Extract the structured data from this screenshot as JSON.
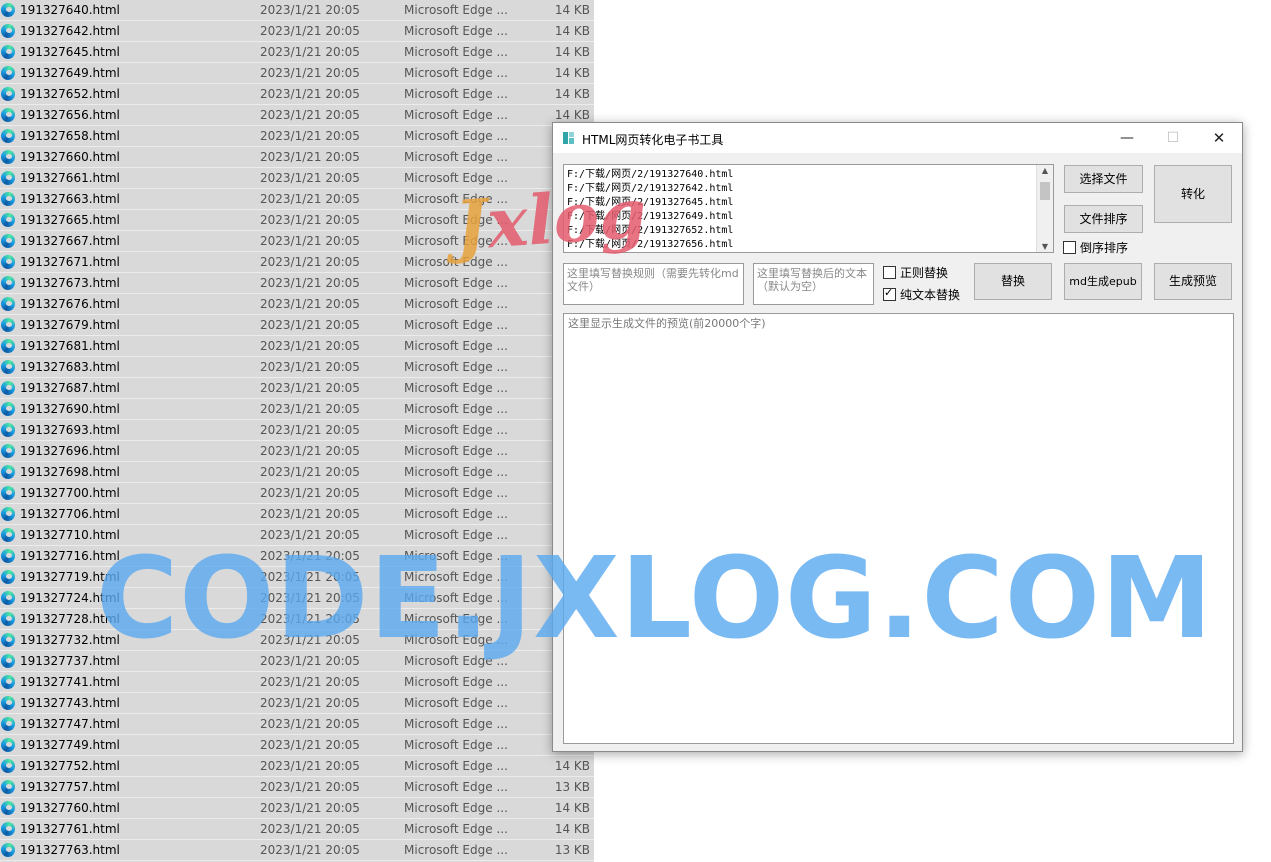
{
  "explorer": {
    "files": [
      {
        "name": "191327640.html",
        "date": "2023/1/21 20:05",
        "type": "Microsoft Edge ...",
        "size": "14 KB"
      },
      {
        "name": "191327642.html",
        "date": "2023/1/21 20:05",
        "type": "Microsoft Edge ...",
        "size": "14 KB"
      },
      {
        "name": "191327645.html",
        "date": "2023/1/21 20:05",
        "type": "Microsoft Edge ...",
        "size": "14 KB"
      },
      {
        "name": "191327649.html",
        "date": "2023/1/21 20:05",
        "type": "Microsoft Edge ...",
        "size": "14 KB"
      },
      {
        "name": "191327652.html",
        "date": "2023/1/21 20:05",
        "type": "Microsoft Edge ...",
        "size": "14 KB"
      },
      {
        "name": "191327656.html",
        "date": "2023/1/21 20:05",
        "type": "Microsoft Edge ...",
        "size": "14 KB"
      },
      {
        "name": "191327658.html",
        "date": "2023/1/21 20:05",
        "type": "Microsoft Edge ...",
        "size": ""
      },
      {
        "name": "191327660.html",
        "date": "2023/1/21 20:05",
        "type": "Microsoft Edge ...",
        "size": ""
      },
      {
        "name": "191327661.html",
        "date": "2023/1/21 20:05",
        "type": "Microsoft Edge ...",
        "size": ""
      },
      {
        "name": "191327663.html",
        "date": "2023/1/21 20:05",
        "type": "Microsoft Edge ...",
        "size": ""
      },
      {
        "name": "191327665.html",
        "date": "2023/1/21 20:05",
        "type": "Microsoft Edge ...",
        "size": ""
      },
      {
        "name": "191327667.html",
        "date": "2023/1/21 20:05",
        "type": "Microsoft Edge ...",
        "size": ""
      },
      {
        "name": "191327671.html",
        "date": "2023/1/21 20:05",
        "type": "Microsoft Edge ...",
        "size": ""
      },
      {
        "name": "191327673.html",
        "date": "2023/1/21 20:05",
        "type": "Microsoft Edge ...",
        "size": ""
      },
      {
        "name": "191327676.html",
        "date": "2023/1/21 20:05",
        "type": "Microsoft Edge ...",
        "size": ""
      },
      {
        "name": "191327679.html",
        "date": "2023/1/21 20:05",
        "type": "Microsoft Edge ...",
        "size": ""
      },
      {
        "name": "191327681.html",
        "date": "2023/1/21 20:05",
        "type": "Microsoft Edge ...",
        "size": ""
      },
      {
        "name": "191327683.html",
        "date": "2023/1/21 20:05",
        "type": "Microsoft Edge ...",
        "size": ""
      },
      {
        "name": "191327687.html",
        "date": "2023/1/21 20:05",
        "type": "Microsoft Edge ...",
        "size": ""
      },
      {
        "name": "191327690.html",
        "date": "2023/1/21 20:05",
        "type": "Microsoft Edge ...",
        "size": ""
      },
      {
        "name": "191327693.html",
        "date": "2023/1/21 20:05",
        "type": "Microsoft Edge ...",
        "size": ""
      },
      {
        "name": "191327696.html",
        "date": "2023/1/21 20:05",
        "type": "Microsoft Edge ...",
        "size": ""
      },
      {
        "name": "191327698.html",
        "date": "2023/1/21 20:05",
        "type": "Microsoft Edge ...",
        "size": ""
      },
      {
        "name": "191327700.html",
        "date": "2023/1/21 20:05",
        "type": "Microsoft Edge ...",
        "size": ""
      },
      {
        "name": "191327706.html",
        "date": "2023/1/21 20:05",
        "type": "Microsoft Edge ...",
        "size": ""
      },
      {
        "name": "191327710.html",
        "date": "2023/1/21 20:05",
        "type": "Microsoft Edge ...",
        "size": ""
      },
      {
        "name": "191327716.html",
        "date": "2023/1/21 20:05",
        "type": "Microsoft Edge ...",
        "size": ""
      },
      {
        "name": "191327719.html",
        "date": "2023/1/21 20:05",
        "type": "Microsoft Edge ...",
        "size": ""
      },
      {
        "name": "191327724.html",
        "date": "2023/1/21 20:05",
        "type": "Microsoft Edge ...",
        "size": ""
      },
      {
        "name": "191327728.html",
        "date": "2023/1/21 20:05",
        "type": "Microsoft Edge ...",
        "size": ""
      },
      {
        "name": "191327732.html",
        "date": "2023/1/21 20:05",
        "type": "Microsoft Edge ...",
        "size": ""
      },
      {
        "name": "191327737.html",
        "date": "2023/1/21 20:05",
        "type": "Microsoft Edge ...",
        "size": ""
      },
      {
        "name": "191327741.html",
        "date": "2023/1/21 20:05",
        "type": "Microsoft Edge ...",
        "size": ""
      },
      {
        "name": "191327743.html",
        "date": "2023/1/21 20:05",
        "type": "Microsoft Edge ...",
        "size": ""
      },
      {
        "name": "191327747.html",
        "date": "2023/1/21 20:05",
        "type": "Microsoft Edge ...",
        "size": ""
      },
      {
        "name": "191327749.html",
        "date": "2023/1/21 20:05",
        "type": "Microsoft Edge ...",
        "size": ""
      },
      {
        "name": "191327752.html",
        "date": "2023/1/21 20:05",
        "type": "Microsoft Edge ...",
        "size": "14 KB"
      },
      {
        "name": "191327757.html",
        "date": "2023/1/21 20:05",
        "type": "Microsoft Edge ...",
        "size": "13 KB"
      },
      {
        "name": "191327760.html",
        "date": "2023/1/21 20:05",
        "type": "Microsoft Edge ...",
        "size": "14 KB"
      },
      {
        "name": "191327761.html",
        "date": "2023/1/21 20:05",
        "type": "Microsoft Edge ...",
        "size": "14 KB"
      },
      {
        "name": "191327763.html",
        "date": "2023/1/21 20:05",
        "type": "Microsoft Edge ...",
        "size": "13 KB"
      }
    ]
  },
  "window": {
    "title": "HTML网页转化电子书工具",
    "minimize": "—",
    "maximize": "☐",
    "close": "✕"
  },
  "file_paths": [
    "F:/下载/网页/2/191327640.html",
    "F:/下载/网页/2/191327642.html",
    "F:/下载/网页/2/191327645.html",
    "F:/下载/网页/2/191327649.html",
    "F:/下载/网页/2/191327652.html",
    "F:/下载/网页/2/191327656.html"
  ],
  "buttons": {
    "select_file": "选择文件",
    "sort_file": "文件排序",
    "convert": "转化",
    "replace": "替换",
    "md_epub": "md生成epub",
    "preview": "生成预览"
  },
  "checkboxes": {
    "reverse_sort": {
      "label": "倒序排序",
      "checked": false
    },
    "regex_replace": {
      "label": "正则替换",
      "checked": false
    },
    "plain_text": {
      "label": "纯文本替换",
      "checked": true
    }
  },
  "fields": {
    "rule_placeholder": "这里填写替换规则（需要先转化md文件）",
    "replacement_placeholder": "这里填写替换后的文本（默认为空）",
    "preview_placeholder": "这里显示生成文件的预览(前20000个字)"
  },
  "watermarks": {
    "logo_first": "J",
    "logo_rest": "xlog",
    "url": "CODE.JXLOG.COM"
  },
  "icons": {
    "file_icon": "edge-icon",
    "app_icon": "app-icon"
  },
  "colors": {
    "explorer_bg": "#d9d9d9",
    "window_bg": "#f0f0f0",
    "watermark_blue": "#5aa9f0",
    "watermark_orange": "#e8a23d",
    "watermark_red": "#e35b6e"
  }
}
